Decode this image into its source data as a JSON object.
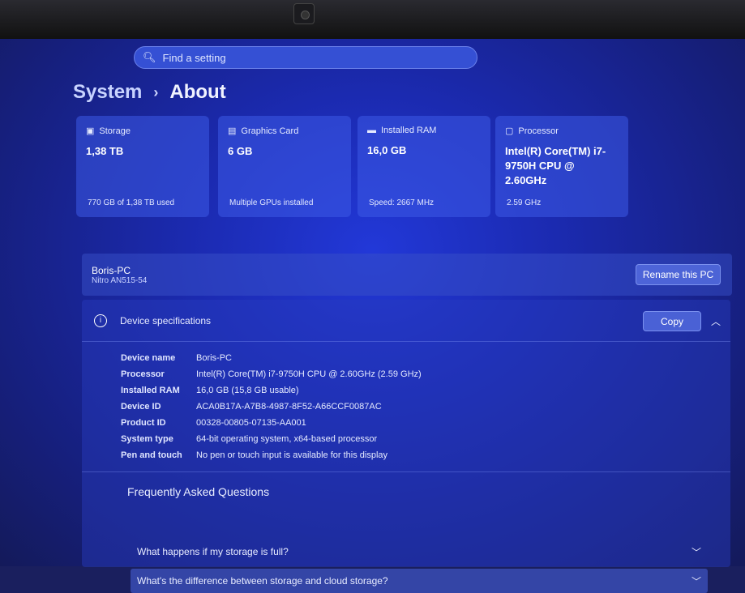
{
  "search": {
    "placeholder": "Find a setting"
  },
  "breadcrumb": {
    "parent": "System",
    "separator": "›",
    "current": "About"
  },
  "cards": [
    {
      "label": "Storage",
      "value": "1,38 TB",
      "sub": "770 GB of 1,38 TB used",
      "icon": "storage-icon"
    },
    {
      "label": "Graphics Card",
      "value": "6 GB",
      "sub": "Multiple GPUs installed",
      "icon": "gpu-icon"
    },
    {
      "label": "Installed RAM",
      "value": "16,0 GB",
      "sub": "Speed: 2667 MHz",
      "icon": "ram-icon"
    },
    {
      "label": "Processor",
      "value": "Intel(R) Core(TM) i7-9750H CPU @ 2.60GHz",
      "sub": "2.59 GHz",
      "icon": "processor-icon"
    }
  ],
  "pc": {
    "name": "Boris-PC",
    "model": "Nitro AN515-54",
    "rename_label": "Rename this PC"
  },
  "specs": {
    "title": "Device specifications",
    "copy_label": "Copy",
    "rows": [
      {
        "k": "Device name",
        "v": "Boris-PC"
      },
      {
        "k": "Processor",
        "v": "Intel(R) Core(TM) i7-9750H CPU @ 2.60GHz (2.59 GHz)"
      },
      {
        "k": "Installed RAM",
        "v": "16,0 GB (15,8 GB usable)"
      },
      {
        "k": "Device ID",
        "v": "ACA0B17A-A7B8-4987-8F52-A66CCF0087AC"
      },
      {
        "k": "Product ID",
        "v": "00328-00805-07135-AA001"
      },
      {
        "k": "System type",
        "v": "64-bit operating system, x64-based processor"
      },
      {
        "k": "Pen and touch",
        "v": "No pen or touch input is available for this display"
      }
    ]
  },
  "faq": {
    "title": "Frequently Asked Questions",
    "items": [
      "What happens if my storage is full?",
      "What's the difference between storage and cloud storage?"
    ]
  }
}
